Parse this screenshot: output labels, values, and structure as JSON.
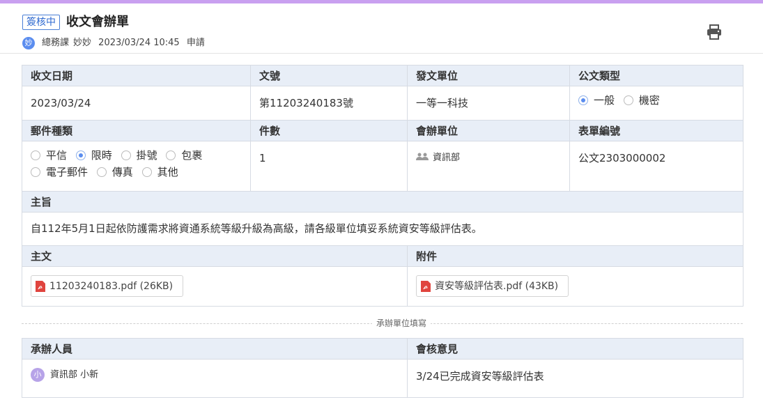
{
  "header": {
    "status_badge": "簽核中",
    "title": "收文會辦單",
    "applicant_avatar": "妙",
    "department": "總務課",
    "applicant_name": "妙妙",
    "datetime": "2023/03/24 10:45",
    "action": "申請",
    "print_icon": "printer-icon"
  },
  "form": {
    "receive_date_label": "收文日期",
    "receive_date": "2023/03/24",
    "doc_no_label": "文號",
    "doc_no": "第11203240183號",
    "issuer_label": "發文單位",
    "issuer": "一等一科技",
    "doc_type_label": "公文類型",
    "doc_type_options": [
      "一般",
      "機密"
    ],
    "mail_type_label": "郵件種類",
    "mail_type_options_row1": [
      "平信",
      "限時",
      "掛號",
      "包裹"
    ],
    "mail_type_options_row2": [
      "電子郵件",
      "傳真",
      "其他"
    ],
    "count_label": "件數",
    "count": "1",
    "co_unit_label": "會辦單位",
    "co_unit": "資訊部",
    "form_no_label": "表單編號",
    "form_no": "公文2303000002",
    "subject_label": "主旨",
    "subject": "自112年5月1日起依防護需求將資通系統等級升級為高級，請各級單位填妥系統資安等級評估表。",
    "main_doc_label": "主文",
    "main_doc_file": "11203240183.pdf (26KB)",
    "attachment_label": "附件",
    "attachment_file": "資安等級評估表.pdf (43KB)"
  },
  "section_divider": "承辦單位填寫",
  "handler": {
    "handler_label": "承辦人員",
    "handler_avatar": "小",
    "handler_dept": "資訊部",
    "handler_name": "小新",
    "opinion_label": "會核意見",
    "opinion": "3/24已完成資安等級評估表"
  }
}
